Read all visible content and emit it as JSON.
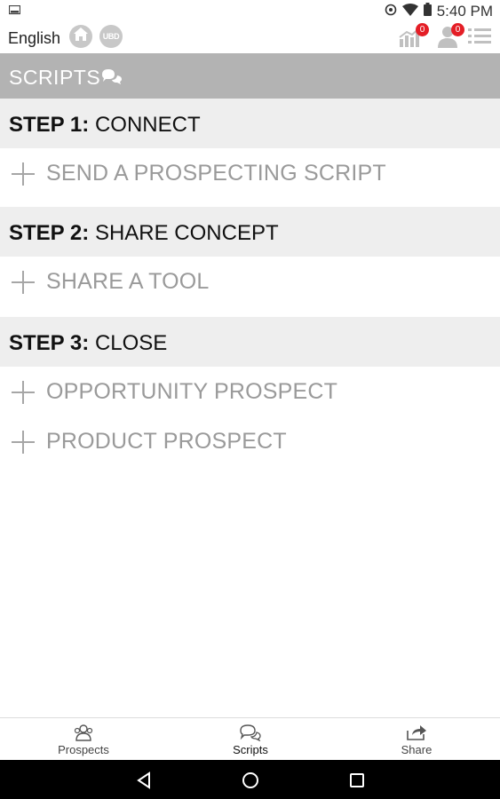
{
  "status_bar": {
    "time": "5:40 PM"
  },
  "header": {
    "language": "English",
    "ubd_label": "UBD",
    "stats_badge": "0",
    "people_badge": "0"
  },
  "scripts_bar": {
    "title": "SCRIPTS"
  },
  "steps": [
    {
      "number_label": "STEP 1:",
      "name": "CONNECT",
      "items": [
        "SEND A PROSPECTING SCRIPT"
      ]
    },
    {
      "number_label": "STEP 2:",
      "name": "SHARE CONCEPT",
      "items": [
        "SHARE A TOOL"
      ]
    },
    {
      "number_label": "STEP 3:",
      "name": "CLOSE",
      "items": [
        "OPPORTUNITY PROSPECT",
        "PRODUCT PROSPECT"
      ]
    }
  ],
  "tabs": [
    {
      "label": "Prospects",
      "icon": "prospects-icon",
      "active": false
    },
    {
      "label": "Scripts",
      "icon": "scripts-chat-icon",
      "active": true
    },
    {
      "label": "Share",
      "icon": "share-icon",
      "active": false
    }
  ],
  "nav": {
    "icons": [
      "back-icon",
      "home-circle-icon",
      "recents-icon"
    ]
  },
  "colors": {
    "scripts_bar": "#b3b3b3",
    "step_header_bg": "#eeeeee",
    "badge": "#e41e26",
    "item_text": "#9a9a9a"
  }
}
